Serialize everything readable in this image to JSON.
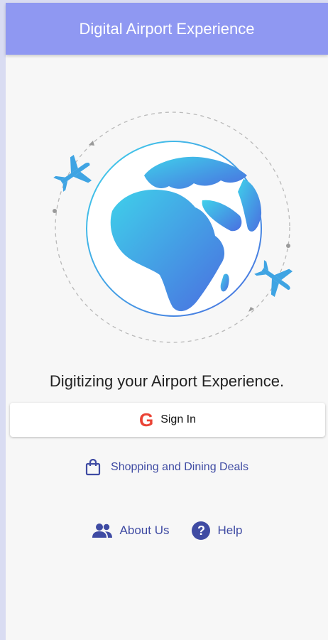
{
  "appbar": {
    "title": "Digital Airport Experience"
  },
  "hero": {
    "icon": "globe-with-airplanes"
  },
  "tagline": "Digitizing your Airport Experience.",
  "signin": {
    "label": "Sign In",
    "logo_letter": "G",
    "icon": "google-icon"
  },
  "deals": {
    "label": "Shopping and Dining Deals",
    "icon": "shopping-bag-icon"
  },
  "links": {
    "about": {
      "label": "About Us",
      "icon": "people-icon"
    },
    "help": {
      "label": "Help",
      "icon": "help-icon",
      "symbol": "?"
    }
  },
  "colors": {
    "appbar": "#8f98f2",
    "accent": "#3f4ba3",
    "globe_start": "#35c7e6",
    "globe_end": "#4a7fe0",
    "google_red": "#ea4335"
  }
}
